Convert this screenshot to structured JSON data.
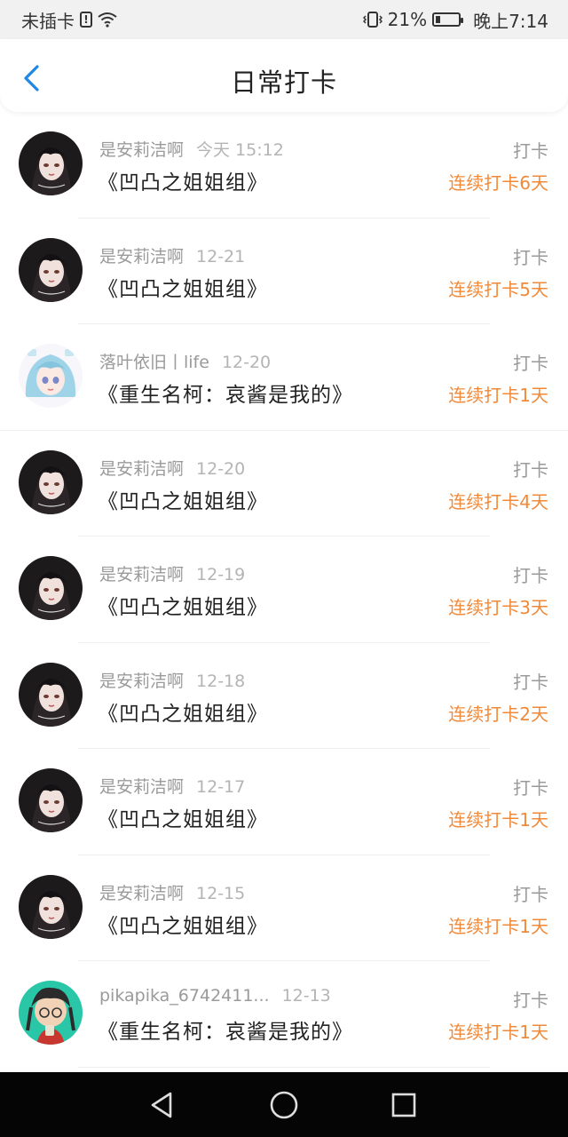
{
  "status_bar": {
    "carrier": "未插卡",
    "battery_percent": "21%",
    "time": "晚上7:14",
    "battery_level": 0.21
  },
  "header": {
    "title": "日常打卡",
    "back_icon": "chevron-left-icon"
  },
  "colors": {
    "accent": "#1e88e5",
    "streak": "#f08a3a",
    "meta": "#9a9a9a"
  },
  "entries": [
    {
      "user": "是安莉洁啊",
      "date": "今天 15:12",
      "book": "《凹凸之姐姐组》",
      "type": "打卡",
      "streak": "连续打卡6天",
      "avatar": "dark-hair-girl"
    },
    {
      "user": "是安莉洁啊",
      "date": "12-21",
      "book": "《凹凸之姐姐组》",
      "type": "打卡",
      "streak": "连续打卡5天",
      "avatar": "dark-hair-girl"
    },
    {
      "user": "落叶依旧丨life",
      "date": "12-20",
      "book": "《重生名柯：哀酱是我的》",
      "type": "打卡",
      "streak": "连续打卡1天",
      "avatar": "blue-hair-girl"
    },
    {
      "user": "是安莉洁啊",
      "date": "12-20",
      "book": "《凹凸之姐姐组》",
      "type": "打卡",
      "streak": "连续打卡4天",
      "avatar": "dark-hair-girl"
    },
    {
      "user": "是安莉洁啊",
      "date": "12-19",
      "book": "《凹凸之姐姐组》",
      "type": "打卡",
      "streak": "连续打卡3天",
      "avatar": "dark-hair-girl"
    },
    {
      "user": "是安莉洁啊",
      "date": "12-18",
      "book": "《凹凸之姐姐组》",
      "type": "打卡",
      "streak": "连续打卡2天",
      "avatar": "dark-hair-girl"
    },
    {
      "user": "是安莉洁啊",
      "date": "12-17",
      "book": "《凹凸之姐姐组》",
      "type": "打卡",
      "streak": "连续打卡1天",
      "avatar": "dark-hair-girl"
    },
    {
      "user": "是安莉洁啊",
      "date": "12-15",
      "book": "《凹凸之姐姐组》",
      "type": "打卡",
      "streak": "连续打卡1天",
      "avatar": "dark-hair-girl"
    },
    {
      "user": "pikapika_6742411...",
      "date": "12-13",
      "book": "《重生名柯：哀酱是我的》",
      "type": "打卡",
      "streak": "连续打卡1天",
      "avatar": "green-cartoon-boy"
    }
  ],
  "nav_bar": {
    "back": "nav-back-icon",
    "home": "nav-home-icon",
    "recents": "nav-recents-icon"
  }
}
